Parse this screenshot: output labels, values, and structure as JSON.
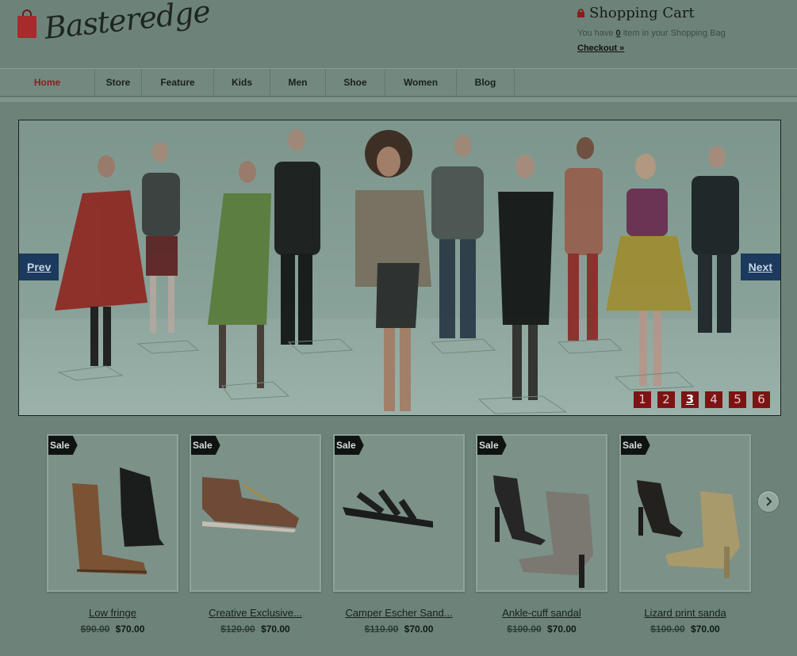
{
  "brand": {
    "name": "Basteredge"
  },
  "cart": {
    "title": "Shopping Cart",
    "msg_prefix": "You have",
    "count": "0",
    "msg_suffix": "item in your Shopping Bag",
    "checkout_label": "Checkout »"
  },
  "nav": {
    "items": [
      {
        "label": "Home"
      },
      {
        "label": "Store"
      },
      {
        "label": "Feature"
      },
      {
        "label": "Kids"
      },
      {
        "label": "Men"
      },
      {
        "label": "Shoe"
      },
      {
        "label": "Women"
      },
      {
        "label": "Blog"
      }
    ]
  },
  "slider": {
    "prev_label": "Prev",
    "next_label": "Next",
    "pages": [
      "1",
      "2",
      "3",
      "4",
      "5",
      "6"
    ],
    "current_page": "3"
  },
  "products": [
    {
      "badge": "Sale",
      "name": "Low fringe",
      "old_price": "$90.00",
      "price": "$70.00"
    },
    {
      "badge": "Sale",
      "name": "Creative Exclusive...",
      "old_price": "$120.00",
      "price": "$70.00"
    },
    {
      "badge": "Sale",
      "name": "Camper Escher Sand...",
      "old_price": "$110.00",
      "price": "$70.00"
    },
    {
      "badge": "Sale",
      "name": "Ankle-cuff sandal",
      "old_price": "$100.00",
      "price": "$70.00"
    },
    {
      "badge": "Sale",
      "name": "Lizard print sanda",
      "old_price": "$100.00",
      "price": "$70.00"
    }
  ],
  "colors": {
    "accent_red": "#7c1414",
    "slider_button_blue": "#1c3a5e",
    "background": "#6d8379"
  }
}
